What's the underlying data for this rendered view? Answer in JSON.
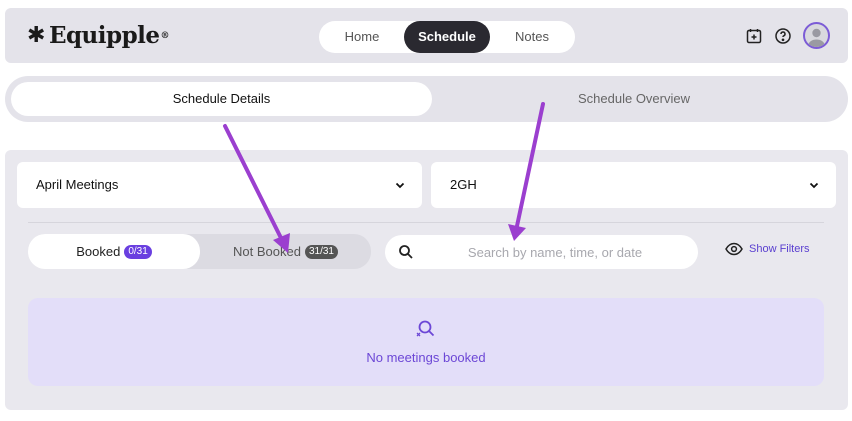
{
  "brand": {
    "name": "Equipple",
    "mark": "✱",
    "registered": "®"
  },
  "nav": {
    "home": "Home",
    "schedule": "Schedule",
    "notes": "Notes"
  },
  "tabs": {
    "details": "Schedule Details",
    "overview": "Schedule Overview"
  },
  "filters": {
    "meeting_select": "April Meetings",
    "location_select": "2GH"
  },
  "booking_toggle": {
    "booked_label": "Booked",
    "booked_count": "0/31",
    "not_booked_label": "Not Booked",
    "not_booked_count": "31/31"
  },
  "search": {
    "placeholder": "Search by name, time, or date",
    "value": ""
  },
  "show_filters": "Show Filters",
  "empty_state": {
    "message": "No meetings booked"
  },
  "colors": {
    "accent": "#6a3fe0",
    "annotation_arrow": "#9b3fcf",
    "active_nav": "#2a2930"
  }
}
